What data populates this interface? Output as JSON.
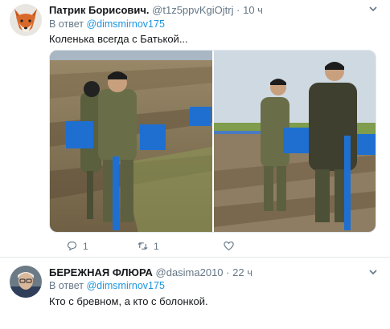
{
  "tweets": [
    {
      "author_name": "Патрик Борисович.",
      "author_handle": "@t1z5ppvKgiOjtrj",
      "dot": "·",
      "time": "10 ч",
      "reply_prefix": "В ответ",
      "reply_to": "@dimsmirnov175",
      "text": "Коленька всегда с Батькой...",
      "actions": {
        "replies": "1",
        "retweets": "1",
        "likes": ""
      }
    },
    {
      "author_name": "БЕРЕЖНАЯ ФЛЮРА",
      "author_handle": "@dasima2010",
      "dot": "·",
      "time": "22 ч",
      "reply_prefix": "В ответ",
      "reply_to": "@dimsmirnov175",
      "text": "Кто с бревном, а кто с болонкой."
    }
  ],
  "icons": {
    "reply": "reply-icon",
    "retweet": "retweet-icon",
    "like": "heart-icon",
    "more": "chevron-down-icon"
  },
  "colors": {
    "link": "#1b95e0",
    "secondary_text": "#657786",
    "divider": "#e1e8ed"
  }
}
